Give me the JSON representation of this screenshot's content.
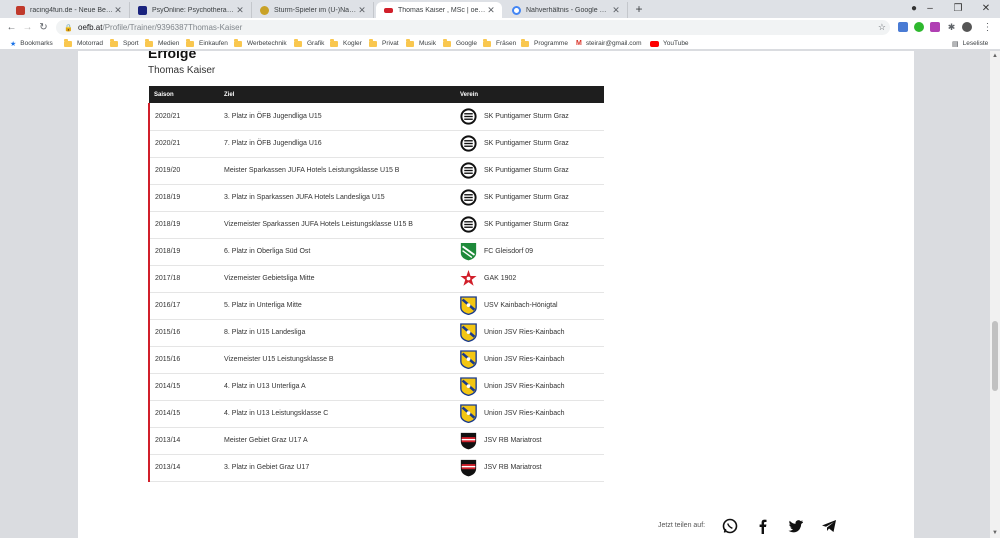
{
  "browser": {
    "tabs": [
      {
        "label": "racing4fun.de - Neue Beiträge",
        "color": "#c0392b"
      },
      {
        "label": "PsyOnline: Psychotherapie in Gr...",
        "color": "#1a237e"
      },
      {
        "label": "Sturm-Spieler im (U-)Nationalte...",
        "color": "#c9a227"
      },
      {
        "label": "Thomas Kaiser , MSc | oefb.at",
        "color": "#d11f2a"
      },
      {
        "label": "Nahverhältnis - Google Suche",
        "color": "#4285f4"
      }
    ],
    "active_tab": 3,
    "new_tab": "+",
    "url_host": "oefb.at",
    "url_path": "/Profile/Trainer/9396387Thomas-Kaiser",
    "bookmarks": [
      {
        "label": "Bookmarks",
        "type": "star"
      },
      {
        "label": "Motorrad",
        "type": "folder"
      },
      {
        "label": "Sport",
        "type": "folder"
      },
      {
        "label": "Medien",
        "type": "folder"
      },
      {
        "label": "Einkaufen",
        "type": "folder"
      },
      {
        "label": "Werbetechnik",
        "type": "folder"
      },
      {
        "label": "Grafik",
        "type": "folder"
      },
      {
        "label": "Kogler",
        "type": "folder"
      },
      {
        "label": "Privat",
        "type": "folder"
      },
      {
        "label": "Musik",
        "type": "folder"
      },
      {
        "label": "Google",
        "type": "folder"
      },
      {
        "label": "Fräsen",
        "type": "folder"
      },
      {
        "label": "Programme",
        "type": "folder"
      },
      {
        "label": "steirair@gmail.com",
        "type": "gmail"
      },
      {
        "label": "YouTube",
        "type": "youtube"
      }
    ],
    "reading_list": "Leseliste"
  },
  "page": {
    "title": "Erfolge",
    "subtitle": "Thomas Kaiser",
    "table_headers": {
      "season": "Saison",
      "goal": "Ziel",
      "club": "Verein"
    },
    "rows": [
      {
        "season": "2020/21",
        "goal": "3. Platz in ÖFB Jugendliga U15",
        "club": "SK Puntigamer Sturm Graz",
        "crest": "sturm"
      },
      {
        "season": "2020/21",
        "goal": "7. Platz in ÖFB Jugendliga U16",
        "club": "SK Puntigamer Sturm Graz",
        "crest": "sturm"
      },
      {
        "season": "2019/20",
        "goal": "Meister Sparkassen JUFA Hotels Leistungsklasse U15 B",
        "club": "SK Puntigamer Sturm Graz",
        "crest": "sturm"
      },
      {
        "season": "2018/19",
        "goal": "3. Platz in Sparkassen JUFA Hotels Landesliga U15",
        "club": "SK Puntigamer Sturm Graz",
        "crest": "sturm"
      },
      {
        "season": "2018/19",
        "goal": "Vizemeister Sparkassen JUFA Hotels Leistungsklasse U15 B",
        "club": "SK Puntigamer Sturm Graz",
        "crest": "sturm"
      },
      {
        "season": "2018/19",
        "goal": "6. Platz in Oberliga Süd Ost",
        "club": "FC Gleisdorf 09",
        "crest": "gleisdorf"
      },
      {
        "season": "2017/18",
        "goal": "Vizemeister Gebietsliga Mitte",
        "club": "GAK 1902",
        "crest": "gak"
      },
      {
        "season": "2016/17",
        "goal": "5. Platz in Unterliga Mitte",
        "club": "USV Kainbach-Hönigtal",
        "crest": "kainbach"
      },
      {
        "season": "2015/16",
        "goal": "8. Platz in U15 Landesliga",
        "club": "Union JSV Ries-Kainbach",
        "crest": "kainbach"
      },
      {
        "season": "2015/16",
        "goal": "Vizemeister U15 Leistungsklasse B",
        "club": "Union JSV Ries-Kainbach",
        "crest": "kainbach"
      },
      {
        "season": "2014/15",
        "goal": "4. Platz in U13 Unterliga A",
        "club": "Union JSV Ries-Kainbach",
        "crest": "kainbach"
      },
      {
        "season": "2014/15",
        "goal": "4. Platz in U13 Leistungsklasse C",
        "club": "Union JSV Ries-Kainbach",
        "crest": "kainbach"
      },
      {
        "season": "2013/14",
        "goal": "Meister Gebiet Graz U17 A",
        "club": "JSV RB Mariatrost",
        "crest": "mariatrost"
      },
      {
        "season": "2013/14",
        "goal": "3. Platz in Gebiet Graz U17",
        "club": "JSV RB Mariatrost",
        "crest": "mariatrost"
      }
    ],
    "share_label": "Jetzt teilen auf:",
    "share_icons": [
      "whatsapp-icon",
      "facebook-icon",
      "twitter-icon",
      "telegram-icon"
    ]
  },
  "colors": {
    "accent": "#d11f2a",
    "header_bg": "#1e1e1e"
  }
}
